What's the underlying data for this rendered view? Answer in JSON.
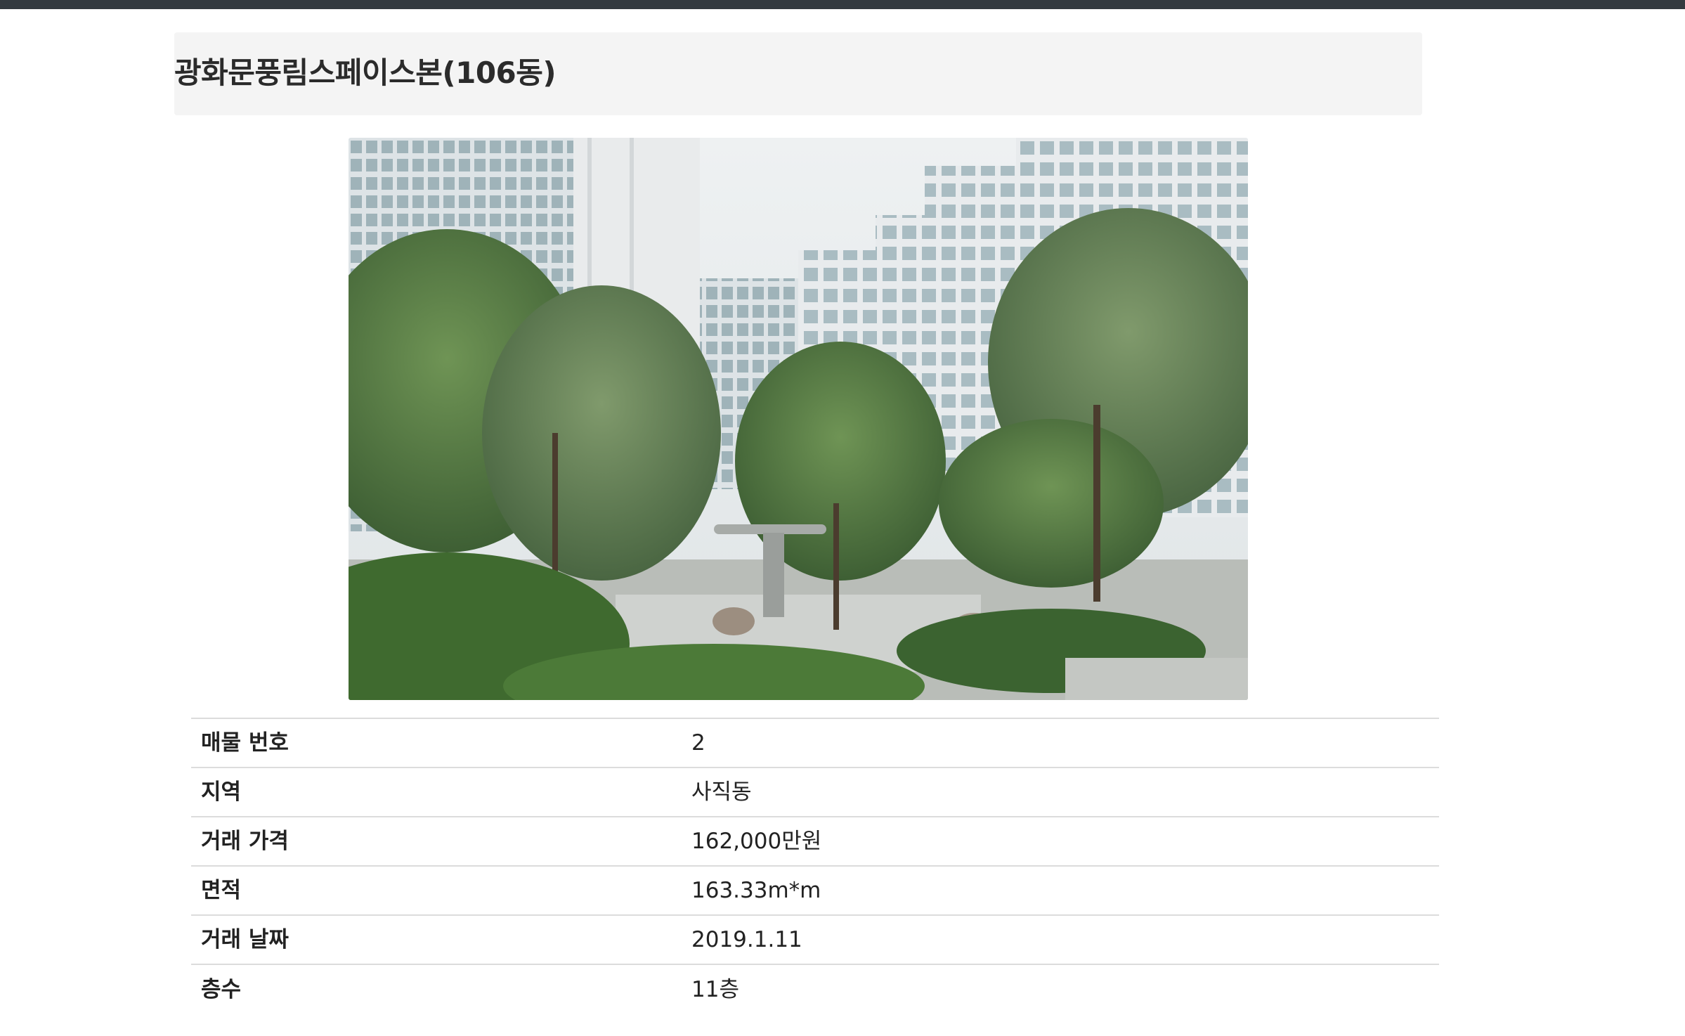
{
  "page": {
    "title": "광화문풍림스페이스본(106동)"
  },
  "photo": {
    "subject": "apartment-courtyard-garden"
  },
  "details": {
    "rows": [
      {
        "label": "매물 번호",
        "value": "2"
      },
      {
        "label": "지역",
        "value": "사직동"
      },
      {
        "label": "거래 가격",
        "value": "162,000만원"
      },
      {
        "label": "면적",
        "value": "163.33m*m"
      },
      {
        "label": "거래 날짜",
        "value": "2019.1.11"
      },
      {
        "label": "층수",
        "value": "11층"
      }
    ]
  },
  "colors": {
    "top_bar": "#343a40",
    "title_bg": "#f4f4f4",
    "row_border": "#dcdcdc"
  }
}
